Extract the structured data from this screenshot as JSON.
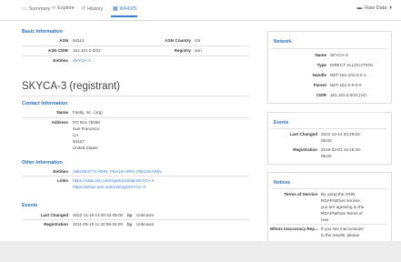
{
  "tabs": [
    {
      "label": "Summary",
      "icon": "monitor-icon"
    },
    {
      "label": "Explore",
      "icon": "binoculars-icon"
    },
    {
      "label": "History",
      "icon": "history-icon"
    },
    {
      "label": "WHOIS",
      "icon": "whois-icon"
    }
  ],
  "raw_data_label": "Raw Data",
  "basic": {
    "title": "Basic Information",
    "asn_label": "ASN",
    "asn": "54113",
    "asn_country_label": "ASN Country",
    "asn_country": "US",
    "asn_cidr_label": "ASN CIDR",
    "asn_cidr": "151.101.0.0/22",
    "registry_label": "Registry",
    "registry": "arin",
    "entities_label": "Entities",
    "entities": "SKYCA-3"
  },
  "entity_heading": "SKYCA-3 (registrant)",
  "contact": {
    "title": "Contact Information",
    "name_label": "Name",
    "name": "Fastly, Inc. (org)",
    "address_label": "Address",
    "address": [
      "PO Box 78266",
      "San Francisco",
      "CA",
      "94107",
      "United States"
    ]
  },
  "other": {
    "title": "Other Information",
    "entities_label": "Entities",
    "entities": "ABUSE4771-ARIN, FNA19-ARIN, FNO19-ARIN",
    "links_label": "Links",
    "links": [
      "https://rdap.arin.net/registry/entity/SKYCA-3",
      "https://whois.arin.net/rest/org/SKYCA-3"
    ]
  },
  "events": {
    "title": "Events",
    "rows": [
      {
        "label": "Last Changed",
        "value": "2022-11-16 14:00:42-05:00",
        "by": "by",
        "who": "Unknown"
      },
      {
        "label": "Registration",
        "value": "2011-09-16 11:42:58-04:00",
        "by": "by",
        "who": "Unknown"
      }
    ]
  },
  "network": {
    "title": "Network",
    "name_label": "Name",
    "name": "SKYCA-3",
    "type_label": "Type",
    "type": "DIRECT ALLOCATION",
    "handle_label": "Handle",
    "handle": "NET-151-101-0-0-1",
    "parent_label": "Parent",
    "parent": "NET-151-0-0-0-0",
    "cidr_label": "CIDR",
    "cidr": "151.101.0.0/16 (v4)"
  },
  "side_events": {
    "title": "Events",
    "last_changed_label": "Last Changed",
    "last_changed": [
      "2021-12-14 20:28:54-",
      "05:00"
    ],
    "registration_label": "Registration",
    "registration": [
      "2016-02-01 15:18:40-",
      "05:00"
    ]
  },
  "notices": {
    "title": "Notices",
    "tos_label": "Terms of Service",
    "tos": [
      "By using the ARIN",
      "RDAP/Whois service,",
      "you are agreeing to the",
      "RDAP/Whois Terms of",
      "Use"
    ],
    "inacc_label": "Whois Inaccuracy Rep...",
    "inacc": [
      "If you see inaccuracies",
      "in the results, please"
    ]
  }
}
